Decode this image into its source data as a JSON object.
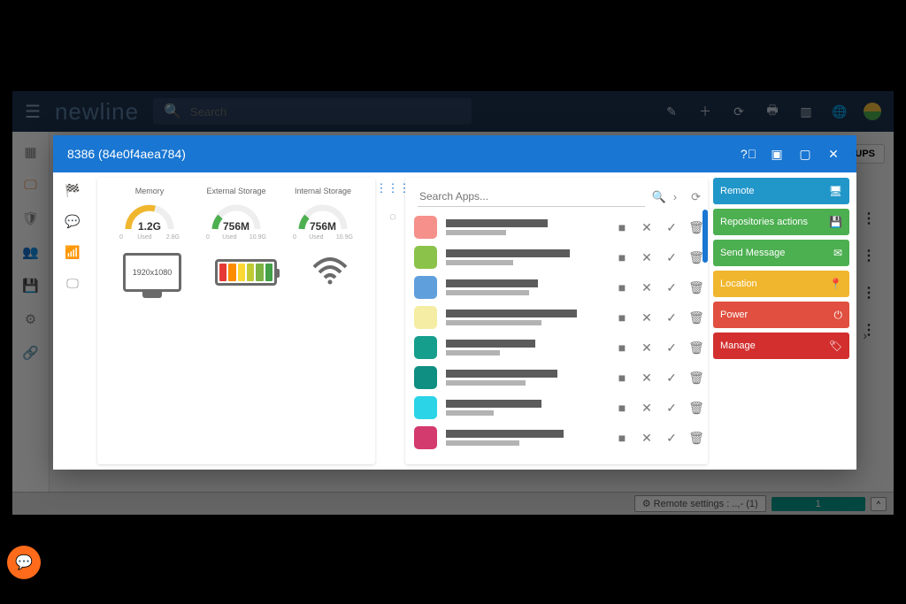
{
  "header": {
    "logo": "newline",
    "search_placeholder": "Search"
  },
  "background": {
    "groups_button": "OUPS",
    "status_label": "⚙ Remote settings : ..,- (1)",
    "status_number": "1",
    "status_caret": "^"
  },
  "modal": {
    "title": "8386 (84e0f4aea784)"
  },
  "gauges": {
    "memory": {
      "label": "Memory",
      "value": "1.2G",
      "min": "0",
      "max": "2.8G",
      "used": "Used"
    },
    "external": {
      "label": "External Storage",
      "value": "756M",
      "min": "0",
      "max": "10.9G",
      "used": "Used"
    },
    "internal": {
      "label": "Internal Storage",
      "value": "756M",
      "min": "0",
      "max": "10.9G",
      "used": "Used"
    }
  },
  "display": {
    "resolution": "1920x1080"
  },
  "apps": {
    "search_placeholder": "Search Apps...",
    "rows": [
      {
        "i": 0,
        "color": "#f6908a",
        "w1": 64,
        "w2": 38
      },
      {
        "i": 1,
        "color": "#8bc34a",
        "w1": 78,
        "w2": 42
      },
      {
        "i": 2,
        "color": "#5f9fdc",
        "w1": 58,
        "w2": 52
      },
      {
        "i": 3,
        "color": "#f4eda3",
        "w1": 82,
        "w2": 60
      },
      {
        "i": 4,
        "color": "#159e8c",
        "w1": 56,
        "w2": 34
      },
      {
        "i": 5,
        "color": "#0f8e82",
        "w1": 70,
        "w2": 50
      },
      {
        "i": 6,
        "color": "#2bd4e6",
        "w1": 60,
        "w2": 30
      },
      {
        "i": 7,
        "color": "#d33a6e",
        "w1": 74,
        "w2": 46
      }
    ]
  },
  "actions": [
    {
      "label": "Remote",
      "color": "#2196c9",
      "icon": "🖥"
    },
    {
      "label": "Repositories actions",
      "color": "#4caf50",
      "icon": "💾"
    },
    {
      "label": "Send Message",
      "color": "#4caf50",
      "icon": "✉"
    },
    {
      "label": "Location",
      "color": "#f0b62e",
      "icon": "📍"
    },
    {
      "label": "Power",
      "color": "#e04f3f",
      "icon": "⏻"
    },
    {
      "label": "Manage",
      "color": "#d32f2f",
      "icon": "🏷"
    }
  ]
}
